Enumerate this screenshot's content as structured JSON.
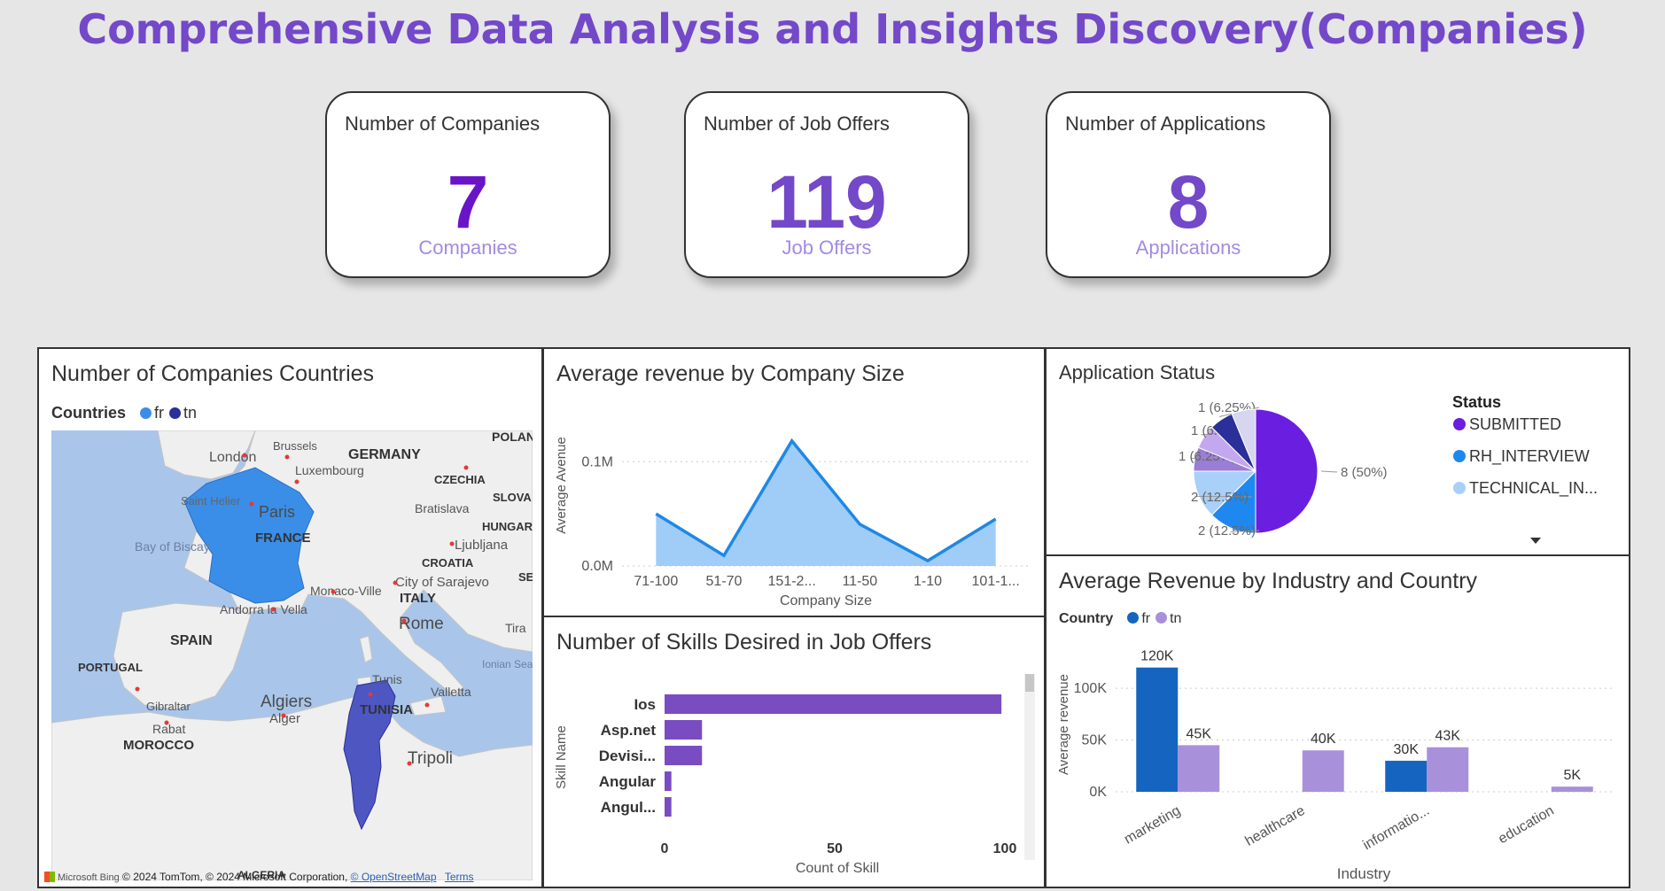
{
  "title": "Comprehensive Data Analysis and Insights Discovery(Companies)",
  "kpis": [
    {
      "title": "Number of Companies",
      "value": "7",
      "sub": "Companies"
    },
    {
      "title": "Number of Job Offers",
      "value": "119",
      "sub": "Job Offers"
    },
    {
      "title": "Number of Applications",
      "value": "8",
      "sub": "Applications"
    }
  ],
  "map_panel": {
    "title": "Number of Companies Countries",
    "legend_label": "Countries",
    "legend_items": [
      {
        "label": "fr",
        "color": "#3a8ee8"
      },
      {
        "label": "tn",
        "color": "#2a2f9a"
      }
    ],
    "place_labels": [
      "London",
      "Brussels",
      "GERMANY",
      "POLAN",
      "Luxembourg",
      "CZECHIA",
      "SLOVA",
      "Saint Helier",
      "Paris",
      "Bratislava",
      "HUNGAR",
      "FRANCE",
      "Ljubljana",
      "Bay of Biscay",
      "CROATIA",
      "City of Sarajevo",
      "SE",
      "Monaco-Ville",
      "ITALY",
      "Andorra la Vella",
      "Rome",
      "Tira",
      "SPAIN",
      "PORTUGAL",
      "Ionian Sea",
      "Tunis",
      "Valletta",
      "Gibraltar",
      "Algiers",
      "Alger",
      "TUNISIA",
      "Rabat",
      "MOROCCO",
      "Tripoli",
      "ALGERIA"
    ],
    "copyright": "© 2024 TomTom, © 2024 Microsoft Corporation,",
    "brand": "Microsoft Bing",
    "osm_link": "© OpenStreetMap",
    "terms_link": "Terms"
  },
  "chart_data": [
    {
      "type": "area",
      "title": "Average revenue by Company Size",
      "xlabel": "Company Size",
      "ylabel": "Average Avenue",
      "categories": [
        "71-100",
        "51-70",
        "151-2...",
        "11-50",
        "1-10",
        "101-1..."
      ],
      "values": [
        50000,
        10000,
        120000,
        40000,
        5000,
        45000
      ],
      "yticks": [
        "0.0M",
        "0.1M"
      ],
      "ylim": [
        0,
        130000
      ],
      "color": "#1e88e5"
    },
    {
      "type": "bar",
      "orientation": "horizontal",
      "title": "Number of Skills Desired in Job Offers",
      "xlabel": "Count of Skill",
      "ylabel": "Skill Name",
      "categories": [
        "Ios",
        "Asp.net",
        "Devisi...",
        "Angular",
        "Angul..."
      ],
      "values": [
        99,
        11,
        11,
        2,
        2
      ],
      "xticks": [
        "0",
        "50",
        "100"
      ],
      "xlim": [
        0,
        100
      ],
      "color": "#7a4cc2"
    },
    {
      "type": "pie",
      "title": "Application Status",
      "legend_title": "Status",
      "legend": [
        "SUBMITTED",
        "RH_INTERVIEW",
        "TECHNICAL_IN..."
      ],
      "slices": [
        {
          "label": "8 (50%)",
          "value": 8,
          "color": "#6a1ee0"
        },
        {
          "label": "2 (12.5%)",
          "value": 2,
          "color": "#1e88f0"
        },
        {
          "label": "2 (12.5%)",
          "value": 2,
          "color": "#a8d0f8"
        },
        {
          "label": "1 (6.25%)",
          "value": 1,
          "color": "#9a7dd4"
        },
        {
          "label": "1 (6.25%)",
          "value": 1,
          "color": "#c4a8ef"
        },
        {
          "label": "1 (6.25%)",
          "value": 1,
          "color": "#2a2f9a"
        },
        {
          "label": "",
          "value": 1,
          "color": "#d6d6f0"
        }
      ]
    },
    {
      "type": "bar",
      "title": "Average Revenue by Industry and Country",
      "legend_title": "Country",
      "xlabel": "Industry",
      "ylabel": "Average revenue",
      "categories": [
        "marketing",
        "healthcare",
        "informatio...",
        "education"
      ],
      "series": [
        {
          "name": "fr",
          "color": "#1565c0",
          "values": [
            120000,
            null,
            30000,
            null
          ],
          "labels": [
            "120K",
            "",
            "30K",
            ""
          ]
        },
        {
          "name": "tn",
          "color": "#a990db",
          "values": [
            45000,
            40000,
            43000,
            5000
          ],
          "labels": [
            "45K",
            "40K",
            "43K",
            "5K"
          ]
        }
      ],
      "yticks": [
        "0K",
        "50K",
        "100K"
      ],
      "ylim": [
        0,
        130000
      ]
    }
  ]
}
